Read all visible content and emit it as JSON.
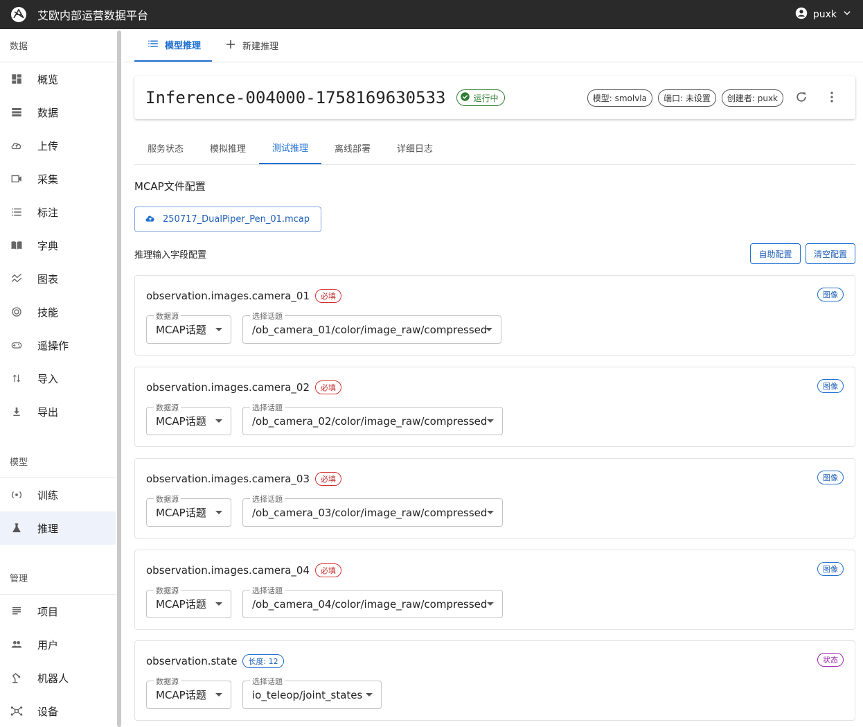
{
  "app": {
    "title": "艾欧内部运营数据平台",
    "user": "puxk"
  },
  "sidebar": {
    "sections": [
      {
        "title": "数据",
        "items": [
          {
            "label": "概览",
            "icon": "dashboard-icon"
          },
          {
            "label": "数据",
            "icon": "storage-icon"
          },
          {
            "label": "上传",
            "icon": "cloud-upload-icon"
          },
          {
            "label": "采集",
            "icon": "video-camera-icon"
          },
          {
            "label": "标注",
            "icon": "list-icon"
          },
          {
            "label": "字典",
            "icon": "book-icon"
          },
          {
            "label": "图表",
            "icon": "chart-icon"
          },
          {
            "label": "技能",
            "icon": "target-icon"
          },
          {
            "label": "遥操作",
            "icon": "gamepad-icon"
          },
          {
            "label": "导入",
            "icon": "swap-icon"
          },
          {
            "label": "导出",
            "icon": "download-icon"
          }
        ]
      },
      {
        "title": "模型",
        "items": [
          {
            "label": "训练",
            "icon": "training-icon"
          },
          {
            "label": "推理",
            "icon": "flask-icon",
            "active": true
          }
        ]
      },
      {
        "title": "管理",
        "items": [
          {
            "label": "项目",
            "icon": "document-icon"
          },
          {
            "label": "用户",
            "icon": "people-icon"
          },
          {
            "label": "机器人",
            "icon": "robot-icon"
          },
          {
            "label": "设备",
            "icon": "device-hub-icon"
          }
        ]
      }
    ]
  },
  "top_tabs": [
    {
      "label": "模型推理",
      "icon": "list-icon",
      "active": true
    },
    {
      "label": "新建推理",
      "icon": "plus-icon",
      "active": false
    }
  ],
  "inference": {
    "name": "Inference-004000-1758169630533",
    "status": "运行中",
    "chips": [
      "模型: smolvla",
      "端口: 未设置",
      "创建者: puxk"
    ]
  },
  "sub_tabs": [
    {
      "label": "服务状态"
    },
    {
      "label": "模拟推理"
    },
    {
      "label": "测试推理",
      "active": true
    },
    {
      "label": "离线部署"
    },
    {
      "label": "详细日志"
    }
  ],
  "mcap": {
    "section_title": "MCAP文件配置",
    "file": "250717_DualPiper_Pen_01.mcap"
  },
  "fields_config": {
    "title": "推理输入字段配置",
    "auto_btn": "自助配置",
    "clear_btn": "清空配置"
  },
  "fields": [
    {
      "name": "observation.images.camera_01",
      "badge": "必填",
      "type": "图像",
      "source_label": "数据源",
      "source": "MCAP话题",
      "topic_label": "选择话题",
      "topic": "/ob_camera_01/color/image_raw/compressed"
    },
    {
      "name": "observation.images.camera_02",
      "badge": "必填",
      "type": "图像",
      "source_label": "数据源",
      "source": "MCAP话题",
      "topic_label": "选择话题",
      "topic": "/ob_camera_02/color/image_raw/compressed"
    },
    {
      "name": "observation.images.camera_03",
      "badge": "必填",
      "type": "图像",
      "source_label": "数据源",
      "source": "MCAP话题",
      "topic_label": "选择话题",
      "topic": "/ob_camera_03/color/image_raw/compressed"
    },
    {
      "name": "observation.images.camera_04",
      "badge": "必填",
      "type": "图像",
      "source_label": "数据源",
      "source": "MCAP话题",
      "topic_label": "选择话题",
      "topic": "/ob_camera_04/color/image_raw/compressed"
    },
    {
      "name": "observation.state",
      "badge": "长度: 12",
      "type": "状态",
      "source_label": "数据源",
      "source": "MCAP话题",
      "topic_label": "选择话题",
      "topic": "io_teleop/joint_states"
    }
  ]
}
